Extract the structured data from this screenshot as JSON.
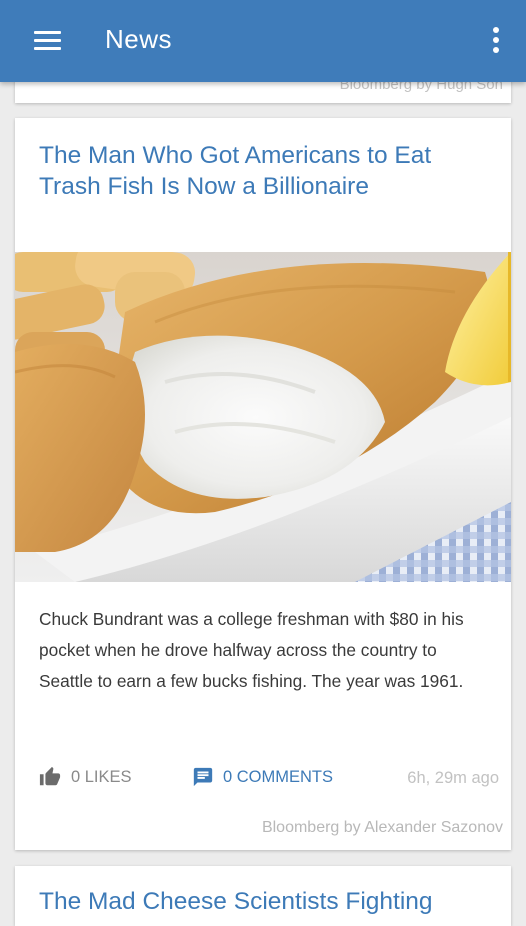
{
  "appbar": {
    "title": "News",
    "menu_icon": "hamburger-menu-icon",
    "overflow_icon": "more-vert-icon",
    "color": "#3f7cba"
  },
  "previous_card": {
    "source": "Bloomberg by Hugh Son"
  },
  "article": {
    "headline": "The Man Who Got Americans to Eat Trash Fish Is Now a Billionaire",
    "image_icon": "fish-and-chips-photo",
    "summary": "Chuck Bundrant was a college freshman with $80 in his pocket when he drove halfway across the country to Seattle to earn a few bucks fishing. The year was 1961.",
    "likes_label": "0 LIKES",
    "comments_label": "0 COMMENTS",
    "timestamp": "6h, 29m ago",
    "source": "Bloomberg by Alexander Sazonov",
    "like_icon": "thumbs-up-icon",
    "comment_icon": "comment-icon"
  },
  "next_card": {
    "headline": "The Mad Cheese Scientists Fighting"
  },
  "colors": {
    "accent": "#3d7ab7",
    "background": "#ececec",
    "muted_text": "#8a8a8a"
  }
}
